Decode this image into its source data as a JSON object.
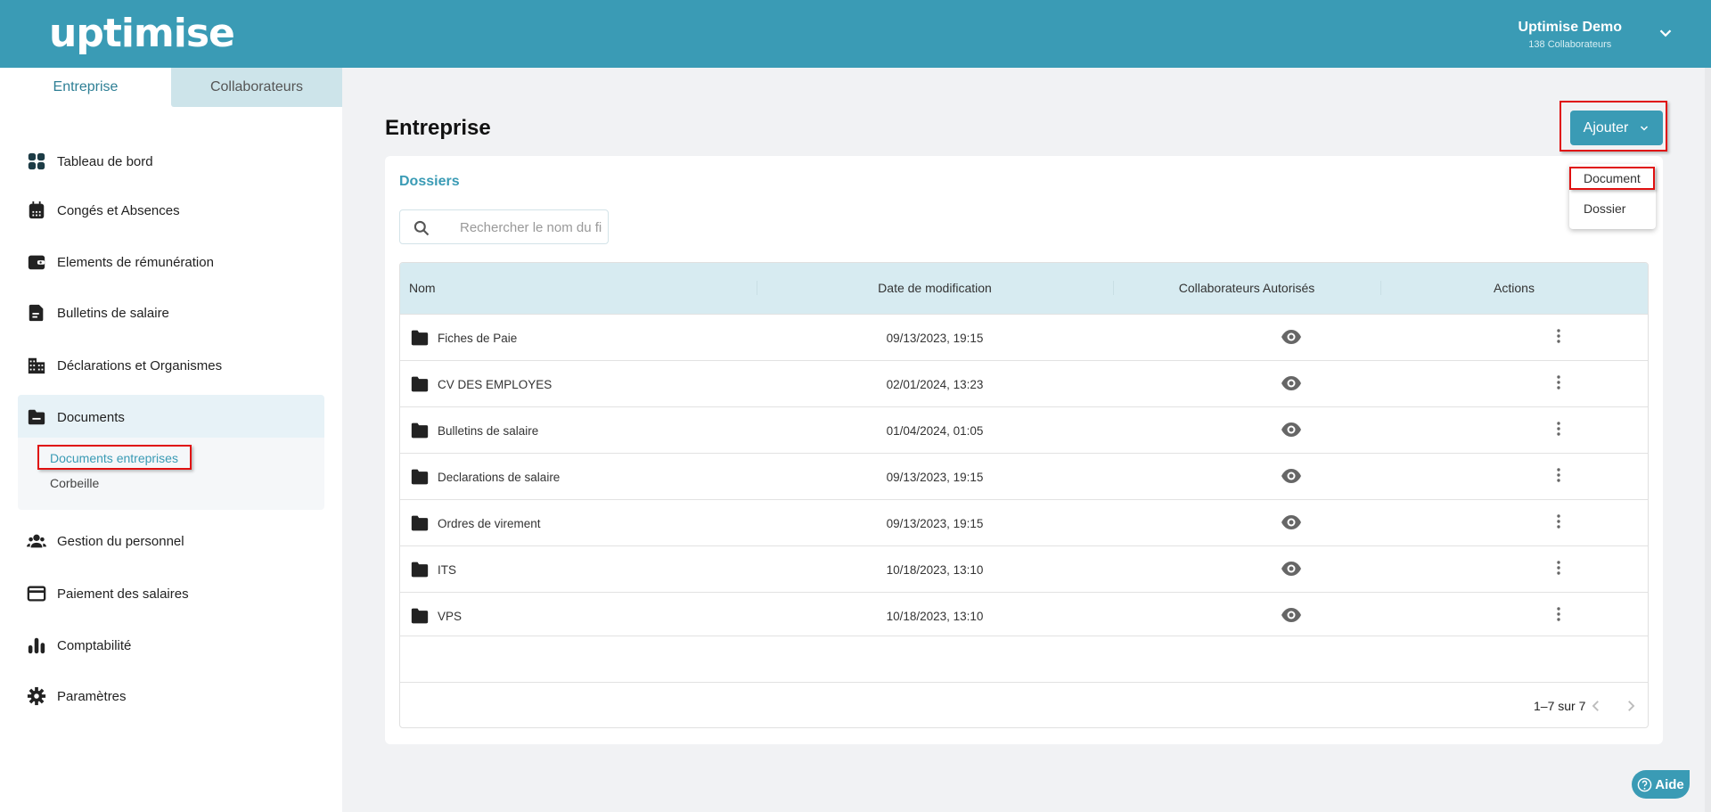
{
  "header": {
    "logo": "uptimise",
    "company": "Uptimise Demo",
    "collaborators": "138 Collaborateurs"
  },
  "sidebar": {
    "tabs": [
      "Entreprise",
      "Collaborateurs"
    ],
    "items": [
      "Tableau de bord",
      "Congés et Absences",
      "Elements de rémunération",
      "Bulletins de salaire",
      "Déclarations et Organismes",
      "Documents",
      "Gestion du personnel",
      "Paiement des salaires",
      "Comptabilité",
      "Paramètres"
    ],
    "documents_sub": [
      "Documents entreprises",
      "Corbeille"
    ]
  },
  "main": {
    "title": "Entreprise",
    "add_button": "Ajouter",
    "add_menu": [
      "Document",
      "Dossier"
    ],
    "section": "Dossiers",
    "search_placeholder": "Rechercher le nom du fichier",
    "columns": [
      "Nom",
      "Date de modification",
      "Collaborateurs Autorisés",
      "Actions"
    ],
    "rows": [
      {
        "name": "Fiches de Paie",
        "date": "09/13/2023, 19:15"
      },
      {
        "name": "CV DES EMPLOYES",
        "date": "02/01/2024, 13:23"
      },
      {
        "name": "Bulletins de salaire",
        "date": "01/04/2024, 01:05"
      },
      {
        "name": "Declarations de salaire",
        "date": "09/13/2023, 19:15"
      },
      {
        "name": "Ordres de virement",
        "date": "09/13/2023, 19:15"
      },
      {
        "name": "ITS",
        "date": "10/18/2023, 13:10"
      },
      {
        "name": "VPS",
        "date": "10/18/2023, 13:10"
      }
    ],
    "pagination": "1–7 sur 7"
  },
  "help": "Aide",
  "colors": {
    "brand": "#3a9bb5",
    "accent": "#f39200"
  }
}
